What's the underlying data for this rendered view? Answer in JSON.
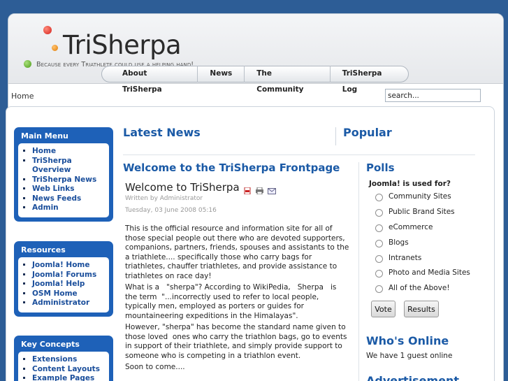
{
  "header": {
    "logo_title": "TriSherpa",
    "logo_tagline": "Because every Triathlete could use a helping hand!"
  },
  "nav": {
    "items": [
      "About TriSherpa",
      "News",
      "The Community",
      "TriSherpa Log"
    ]
  },
  "breadcrumb": "Home",
  "search": {
    "value": "search..."
  },
  "sidebar": {
    "main_menu": {
      "title": "Main Menu",
      "items": [
        "Home",
        "TriSherpa Overview",
        "TriSherpa News",
        "Web Links",
        "News Feeds",
        "Admin"
      ]
    },
    "resources": {
      "title": "Resources",
      "items": [
        "Joomla! Home",
        "Joomla! Forums",
        "Joomla! Help",
        "OSM Home",
        "Administrator"
      ]
    },
    "key_concepts": {
      "title": "Key Concepts",
      "items": [
        "Extensions",
        "Content Layouts",
        "Example Pages"
      ]
    }
  },
  "main": {
    "latest_news": "Latest News",
    "popular": "Popular",
    "frontpage_title": "Welcome to the TriSherpa Frontpage",
    "article": {
      "title": "Welcome to TriSherpa",
      "author": "Written by Administrator",
      "date": "Tuesday, 03 June 2008 05:16",
      "paragraphs": [
        "This is the official resource and information site for all of those special people out there who are devoted supporters, companions, partners, friends, spouses and assistants to the a triathlete.... specifically those who carry bags for triathletes, chauffer triathletes, and provide assistance to triathletes on race day!",
        "What is a   \"sherpa\"? According to WikiPedia,   Sherpa   is the term  \"...incorrectly used to refer to local people, typically men, employed as porters or guides for mountaineering expeditions in the Himalayas\".",
        "However, \"sherpa\" has become the standard name given to those loved  ones who carry the triathlon bags, go to events in support of their triathlete, and simply provide support to someone who is competing in a triathlon event.",
        "Soon to come...."
      ]
    }
  },
  "polls": {
    "title": "Polls",
    "question": "Joomla! is used for?",
    "options": [
      "Community Sites",
      "Public Brand Sites",
      "eCommerce",
      "Blogs",
      "Intranets",
      "Photo and Media Sites",
      "All of the Above!"
    ],
    "vote_label": "Vote",
    "results_label": "Results"
  },
  "whos_online": {
    "title": "Who's Online",
    "text": "We have 1 guest online"
  },
  "advertisement": {
    "title": "Advertisement"
  },
  "colors": {
    "brand_blue": "#1b5aa6",
    "module_blue": "#1e61b8",
    "page_bg": "#2d5d96"
  }
}
